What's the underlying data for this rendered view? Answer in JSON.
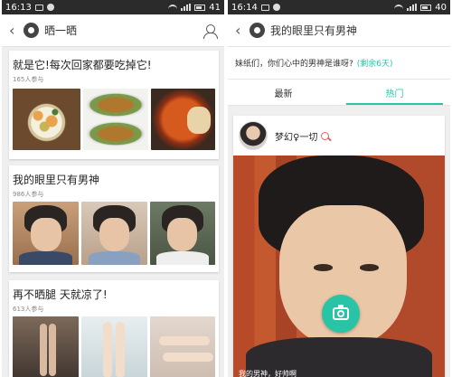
{
  "left": {
    "status": {
      "time": "16:13",
      "battery": "41"
    },
    "topbar": {
      "title": "晒一晒"
    },
    "cards": [
      {
        "title": "就是它!每次回家都要吃掉它!",
        "count": "165人参与"
      },
      {
        "title": "我的眼里只有男神",
        "count": "986人参与"
      },
      {
        "title": "再不晒腿 天就凉了!",
        "count": "613人参与"
      }
    ]
  },
  "right": {
    "status": {
      "time": "16:14",
      "battery": "40"
    },
    "topbar": {
      "title": "我的眼里只有男神"
    },
    "prompt": {
      "text": "妹纸们，你们心中的男神是谁呀?",
      "remaining": "(剩余6天)"
    },
    "tabs": [
      {
        "label": "最新"
      },
      {
        "label": "热门"
      }
    ],
    "active_tab": "热门",
    "post": {
      "username": "梦幻♀一切",
      "caption": "我的男神，好帅啊"
    }
  },
  "colors": {
    "accent": "#29c3a5"
  }
}
